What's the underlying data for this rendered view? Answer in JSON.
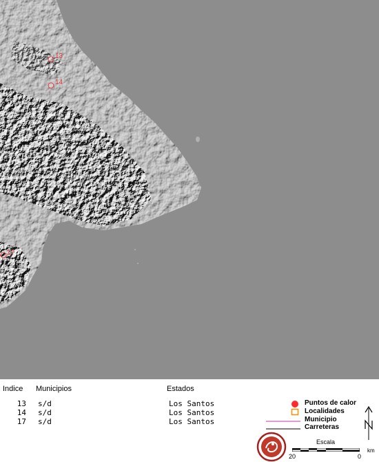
{
  "map": {
    "hotspots": [
      {
        "id": "13",
        "label": "13"
      },
      {
        "id": "14",
        "label": "14"
      },
      {
        "id": "17",
        "label": "17"
      }
    ]
  },
  "table": {
    "headers": {
      "index": "Indice",
      "municipio": "Municipios",
      "estado": "Estados"
    },
    "rows": [
      {
        "index": "13",
        "municipio": "s/d",
        "estado": "Los Santos"
      },
      {
        "index": "14",
        "municipio": "s/d",
        "estado": "Los Santos"
      },
      {
        "index": "17",
        "municipio": "s/d",
        "estado": "Los Santos"
      }
    ]
  },
  "legend": {
    "items": [
      {
        "label": "Puntos de calor",
        "symbol": "red-dot",
        "color": "#ff2a2a"
      },
      {
        "label": "Localidades",
        "symbol": "orange-square",
        "color": "#ff8c00"
      },
      {
        "label": "Municipio",
        "symbol": "magenta-line",
        "color": "#cc3399"
      },
      {
        "label": "Carreteras",
        "symbol": "black-line",
        "color": "#000000"
      }
    ]
  },
  "scale": {
    "title": "Escala",
    "left_value": "20",
    "right_value": "0",
    "unit": "km"
  },
  "colors": {
    "sea": "#8d8d8d",
    "land": "#b4b4b4",
    "hotspot": "#e23b3b"
  },
  "icons": {
    "north": "north-arrow-icon",
    "seal": "institution-seal-icon"
  }
}
